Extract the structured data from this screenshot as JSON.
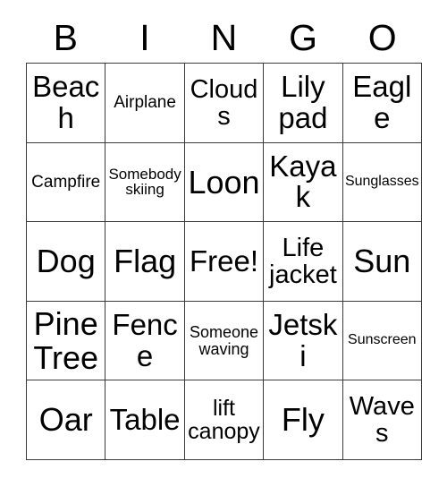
{
  "card": {
    "title_letters": [
      "B",
      "I",
      "N",
      "G",
      "O"
    ],
    "grid_size": 5,
    "free_space": "Free!",
    "colors": {
      "background": "#ffffff",
      "border": "#3a3a3a",
      "text": "#000000"
    },
    "rows": [
      [
        {
          "label": "Beach",
          "size": "xxl"
        },
        {
          "label": "Airplane",
          "size": "md"
        },
        {
          "label": "Clouds",
          "size": "xl"
        },
        {
          "label": "Lily pad",
          "size": "xxl"
        },
        {
          "label": "Eagle",
          "size": "xxl"
        }
      ],
      [
        {
          "label": "Campfire",
          "size": "md"
        },
        {
          "label": "Somebody skiing",
          "size": "sm"
        },
        {
          "label": "Loon",
          "size": "huge"
        },
        {
          "label": "Kayak",
          "size": "xxl"
        },
        {
          "label": "Sunglasses",
          "size": "xs"
        }
      ],
      [
        {
          "label": "Dog",
          "size": "huge"
        },
        {
          "label": "Flag",
          "size": "huge"
        },
        {
          "label": "Free!",
          "size": "xxl"
        },
        {
          "label": "Life jacket",
          "size": "xl"
        },
        {
          "label": "Sun",
          "size": "huge"
        }
      ],
      [
        {
          "label": "Pine Tree",
          "size": "huge"
        },
        {
          "label": "Fence",
          "size": "xxl"
        },
        {
          "label": "Someone waving",
          "size": "smd"
        },
        {
          "label": "Jetski",
          "size": "xxl"
        },
        {
          "label": "Sunscreen",
          "size": "xs"
        }
      ],
      [
        {
          "label": "Oar",
          "size": "huge"
        },
        {
          "label": "Table",
          "size": "xxl"
        },
        {
          "label": "lift canopy",
          "size": "lg"
        },
        {
          "label": "Fly",
          "size": "huge"
        },
        {
          "label": "Waves",
          "size": "xl"
        }
      ]
    ]
  }
}
